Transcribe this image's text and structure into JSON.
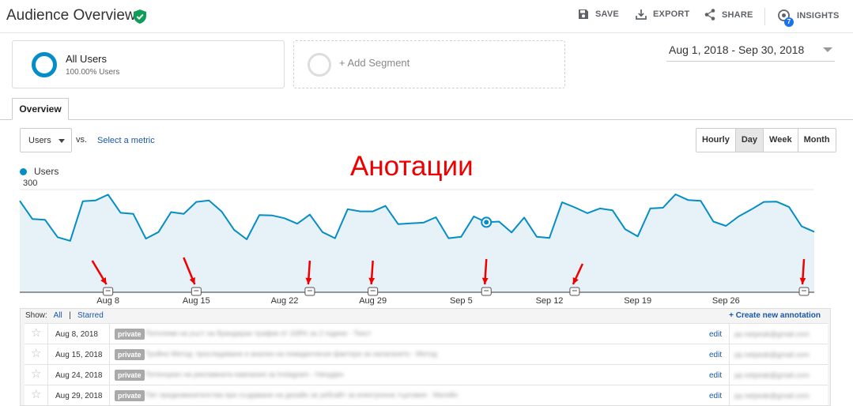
{
  "header": {
    "title": "Audience Overview",
    "save": "SAVE",
    "export": "EXPORT",
    "share": "SHARE",
    "insights": "INSIGHTS",
    "insights_count": "7"
  },
  "segments": {
    "active": {
      "name": "All Users",
      "share": "100.00% Users"
    },
    "add_label": "+ Add Segment"
  },
  "date_range": "Aug 1, 2018 - Sep 30, 2018",
  "tabs": [
    "Overview"
  ],
  "metric": {
    "selected": "Users",
    "vs": "vs.",
    "select_metric": "Select a metric"
  },
  "granularity": {
    "options": [
      "Hourly",
      "Day",
      "Week",
      "Month"
    ],
    "selected": "Day"
  },
  "legend_label": "Users",
  "overlay_text": "Анотации",
  "chart_data": {
    "type": "area",
    "series": [
      {
        "name": "Users",
        "color": "#058dc7",
        "values": [
          269,
          219,
          217,
          169,
          159,
          268,
          270,
          286,
          236,
          233,
          165,
          183,
          238,
          233,
          266,
          270,
          240,
          189,
          163,
          230,
          229,
          221,
          206,
          231,
          183,
          166,
          246,
          240,
          240,
          255,
          205,
          207,
          209,
          224,
          166,
          170,
          226,
          210,
          212,
          182,
          223,
          170,
          167,
          265,
          251,
          235,
          248,
          243,
          191,
          171,
          248,
          250,
          287,
          271,
          269,
          212,
          200,
          226,
          245,
          266,
          267,
          252,
          199,
          184
        ]
      }
    ],
    "x_ticks": [
      "Aug 8",
      "Aug 15",
      "Aug 22",
      "Aug 29",
      "Sep 5",
      "Sep 12",
      "Sep 19",
      "Sep 26"
    ],
    "y_ticks": [
      150,
      300
    ],
    "ylim": [
      0,
      300
    ],
    "highlighted_point_index": 37,
    "annotation_marker_indices": [
      7,
      14,
      23,
      28,
      37,
      44,
      57
    ],
    "grid": "horizontal"
  },
  "annotations": {
    "show_label": "Show:",
    "filter_all": "All",
    "filter_sep": "|",
    "filter_starred": "Starred",
    "create_label": "+ Create new annotation",
    "edit_label": "edit",
    "rows": [
      {
        "date": "Aug 8, 2018",
        "visibility": "private",
        "text": "Поголеми на ръст на брандиран трафик от 168% за 2 години - Текст",
        "author": "pp.netpeak@gmail.com"
      },
      {
        "date": "Aug 15, 2018",
        "visibility": "private",
        "text": "Тройно Метод: проследяване и анализ на поведенчески фактори за налагането - Метод",
        "author": "pp.netpeak@gmail.com"
      },
      {
        "date": "Aug 24, 2018",
        "visibility": "private",
        "text": "Потенциал на рекламната кампания за Instagram - Ненуден",
        "author": "pp.netpeak@gmail.com"
      },
      {
        "date": "Aug 29, 2018",
        "visibility": "private",
        "text": "Пет предизвикателства при създаване на дизайн за уебсайт за електронна търговия - Матейн",
        "author": "pp.netpeak@gmail.com"
      }
    ]
  }
}
